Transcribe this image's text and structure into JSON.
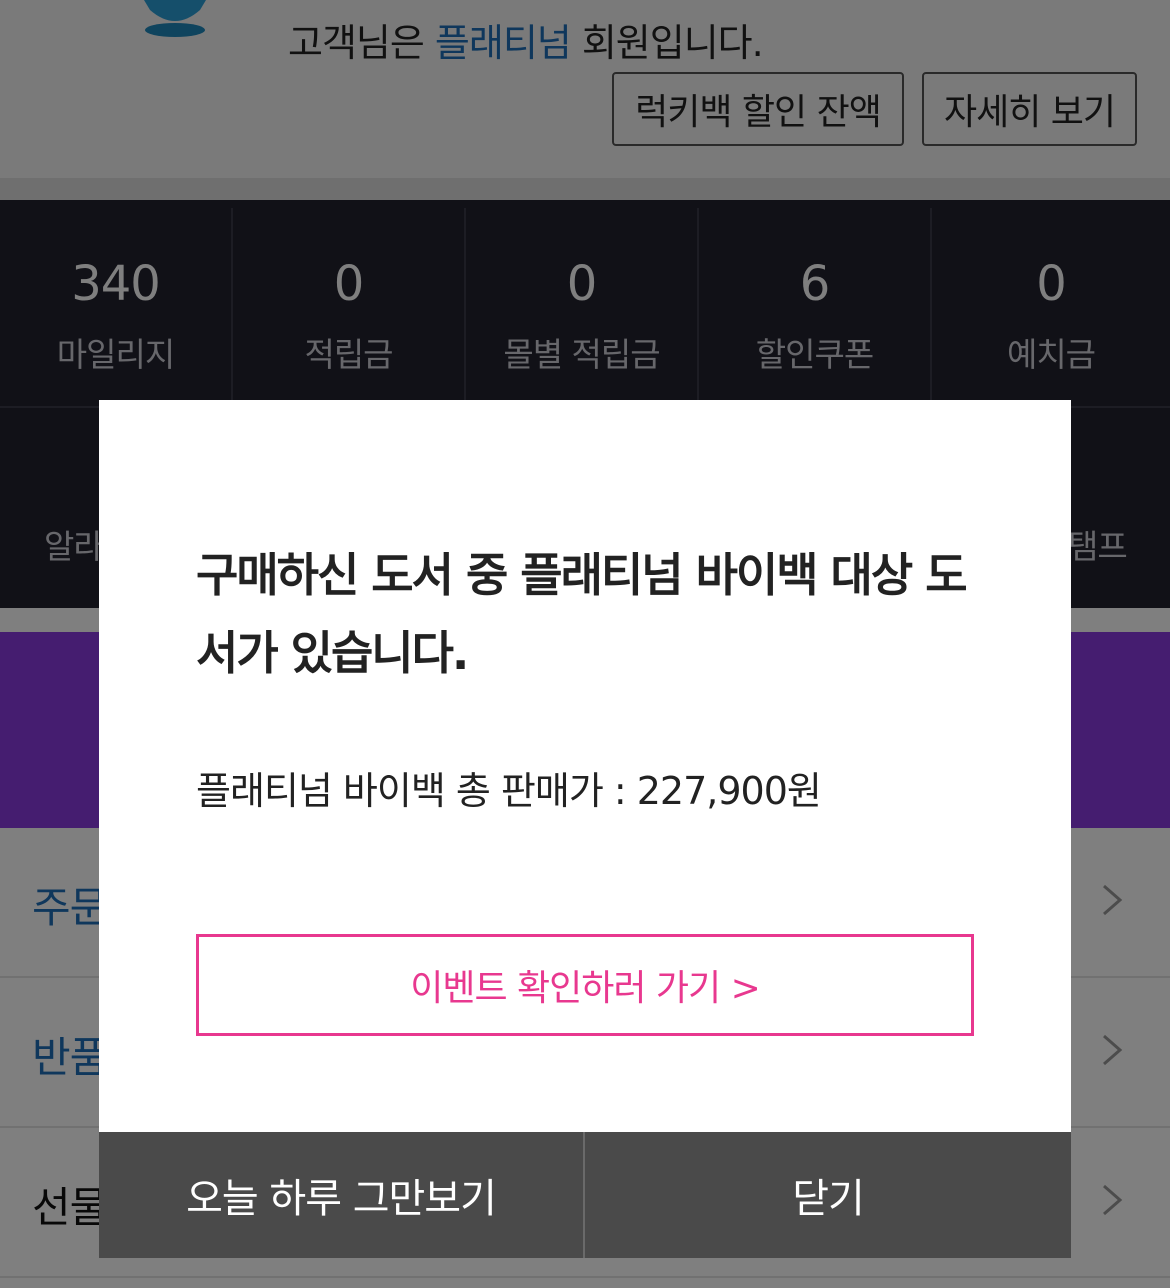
{
  "header": {
    "grade_prefix": "고객님은 ",
    "grade_name": "플래티넘",
    "grade_suffix": " 회원입니다.",
    "luckybag_button": "럭키백 할인 잔액",
    "detail_button": "자세히 보기"
  },
  "stats": [
    {
      "value": "340",
      "label": "마일리지"
    },
    {
      "value": "0",
      "label": "적립금"
    },
    {
      "value": "0",
      "label": "몰별 적립금"
    },
    {
      "value": "6",
      "label": "할인쿠폰"
    },
    {
      "value": "0",
      "label": "예치금"
    }
  ],
  "stats_row2": {
    "left_label": "알라",
    "right_label": "탬프"
  },
  "menu": [
    {
      "label": "주문",
      "color": "blue"
    },
    {
      "label": "반품",
      "color": "blue"
    },
    {
      "label": "선물",
      "color": "dark"
    }
  ],
  "modal": {
    "title": "구매하신 도서 중 플래티넘 바이백 대상 도서가 있습니다.",
    "price_text": "플래티넘 바이백 총 판매가 : 227,900원",
    "event_button": "이벤트 확인하러 가기 >",
    "today_button": "오늘 하루 그만보기",
    "close_button": "닫기"
  },
  "colors": {
    "accent_blue": "#1f6fb8",
    "event_pink": "#e8388f",
    "stats_bg": "#22222e",
    "banner_purple": "#8a3be0",
    "footer_gray": "#4a4a4a"
  }
}
